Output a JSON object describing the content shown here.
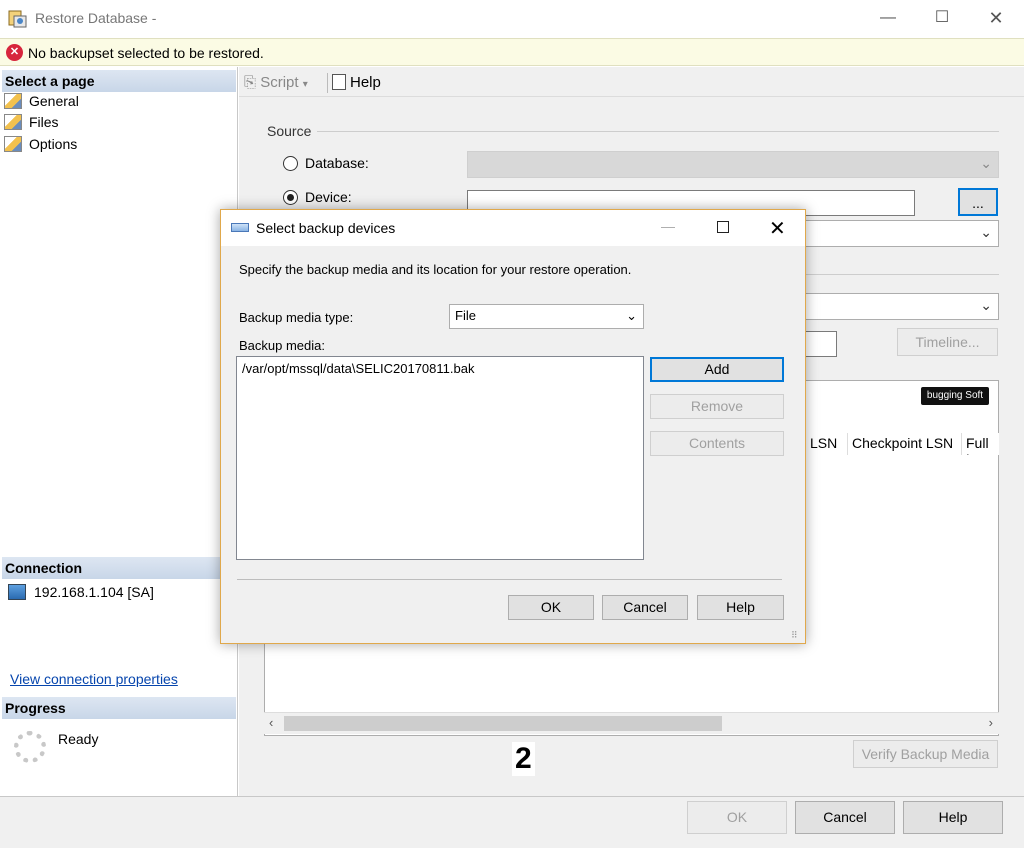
{
  "window": {
    "title": "Restore Database -",
    "minimize_icon": "minimize-icon",
    "maximize_icon": "maximize-icon",
    "close_icon": "close-icon"
  },
  "error_bar": {
    "message": "No backupset selected to be restored.",
    "icon": "error-icon",
    "color": "#d7263d"
  },
  "left_pane": {
    "select_page_header": "Select a page",
    "pages": [
      {
        "label": "General"
      },
      {
        "label": "Files"
      },
      {
        "label": "Options"
      }
    ],
    "connection_header": "Connection",
    "connection_value": "192.168.1.104 [SA]",
    "view_connection_link": "View connection properties",
    "progress_header": "Progress",
    "progress_status": "Ready"
  },
  "toolbar": {
    "script_label": "Script",
    "help_label": "Help"
  },
  "source": {
    "group_label": "Source",
    "database_label": "Database:",
    "device_label": "Device:",
    "browse_button": "...",
    "selected": "Device"
  },
  "background_buttons": {
    "timeline": "Timeline...",
    "verify_backup_media": "Verify Backup Media"
  },
  "grid": {
    "columns": [
      "LSN",
      "Checkpoint LSN",
      "Full L"
    ]
  },
  "overlay_number": "2",
  "watermark": "bugging Soft",
  "footer": {
    "ok": "OK",
    "cancel": "Cancel",
    "help": "Help"
  },
  "dialog": {
    "title": "Select backup devices",
    "description": "Specify the backup media and its location for your restore operation.",
    "media_type_label": "Backup media type:",
    "media_type_value": "File",
    "backup_media_label": "Backup media:",
    "media_items": [
      "/var/opt/mssql/data\\SELIC20170811.bak"
    ],
    "add": "Add",
    "remove": "Remove",
    "contents": "Contents",
    "ok": "OK",
    "cancel": "Cancel",
    "help": "Help"
  }
}
